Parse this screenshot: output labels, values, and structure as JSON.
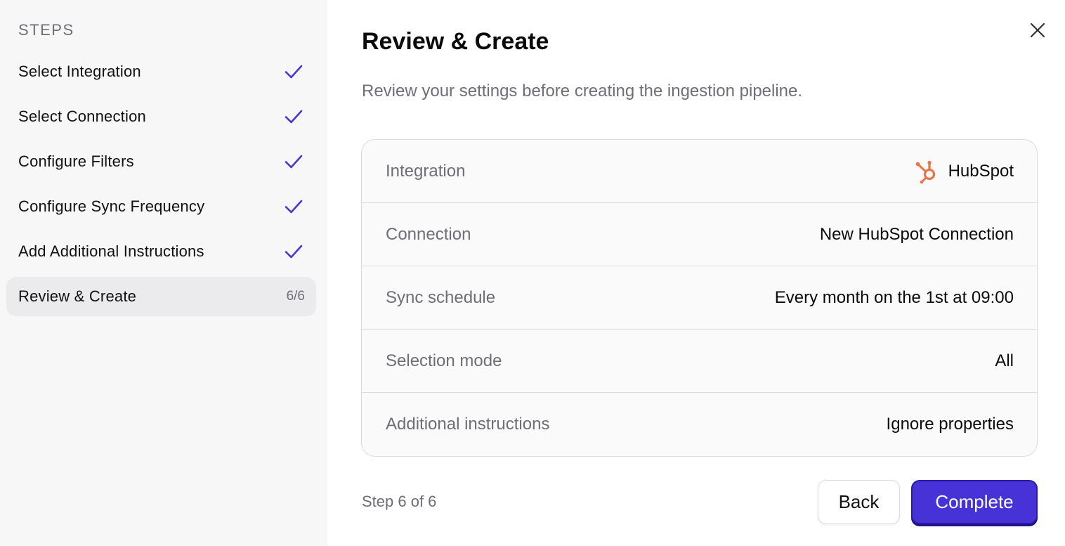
{
  "sidebar": {
    "heading": "STEPS",
    "steps": [
      {
        "label": "Select Integration",
        "status": "done"
      },
      {
        "label": "Select Connection",
        "status": "done"
      },
      {
        "label": "Configure Filters",
        "status": "done"
      },
      {
        "label": "Configure Sync Frequency",
        "status": "done"
      },
      {
        "label": "Add Additional Instructions",
        "status": "done"
      },
      {
        "label": "Review & Create",
        "status": "current",
        "count": "6/6"
      }
    ]
  },
  "main": {
    "title": "Review & Create",
    "subtitle": "Review your settings before creating the ingestion pipeline.",
    "rows": [
      {
        "label": "Integration",
        "value": "HubSpot",
        "icon": "hubspot-icon"
      },
      {
        "label": "Connection",
        "value": "New HubSpot Connection"
      },
      {
        "label": "Sync schedule",
        "value": "Every month on the 1st at 09:00"
      },
      {
        "label": "Selection mode",
        "value": "All"
      },
      {
        "label": "Additional instructions",
        "value": "Ignore properties"
      }
    ],
    "step_indicator": "Step 6 of 6",
    "back_label": "Back",
    "complete_label": "Complete"
  },
  "icons": {
    "close": "close-icon",
    "check": "check-icon",
    "integration": "hubspot-icon"
  },
  "colors": {
    "accent": "#4632d6",
    "check": "#4a35d4",
    "hubspot": "#e8754a",
    "muted_text": "#6e6e76"
  }
}
